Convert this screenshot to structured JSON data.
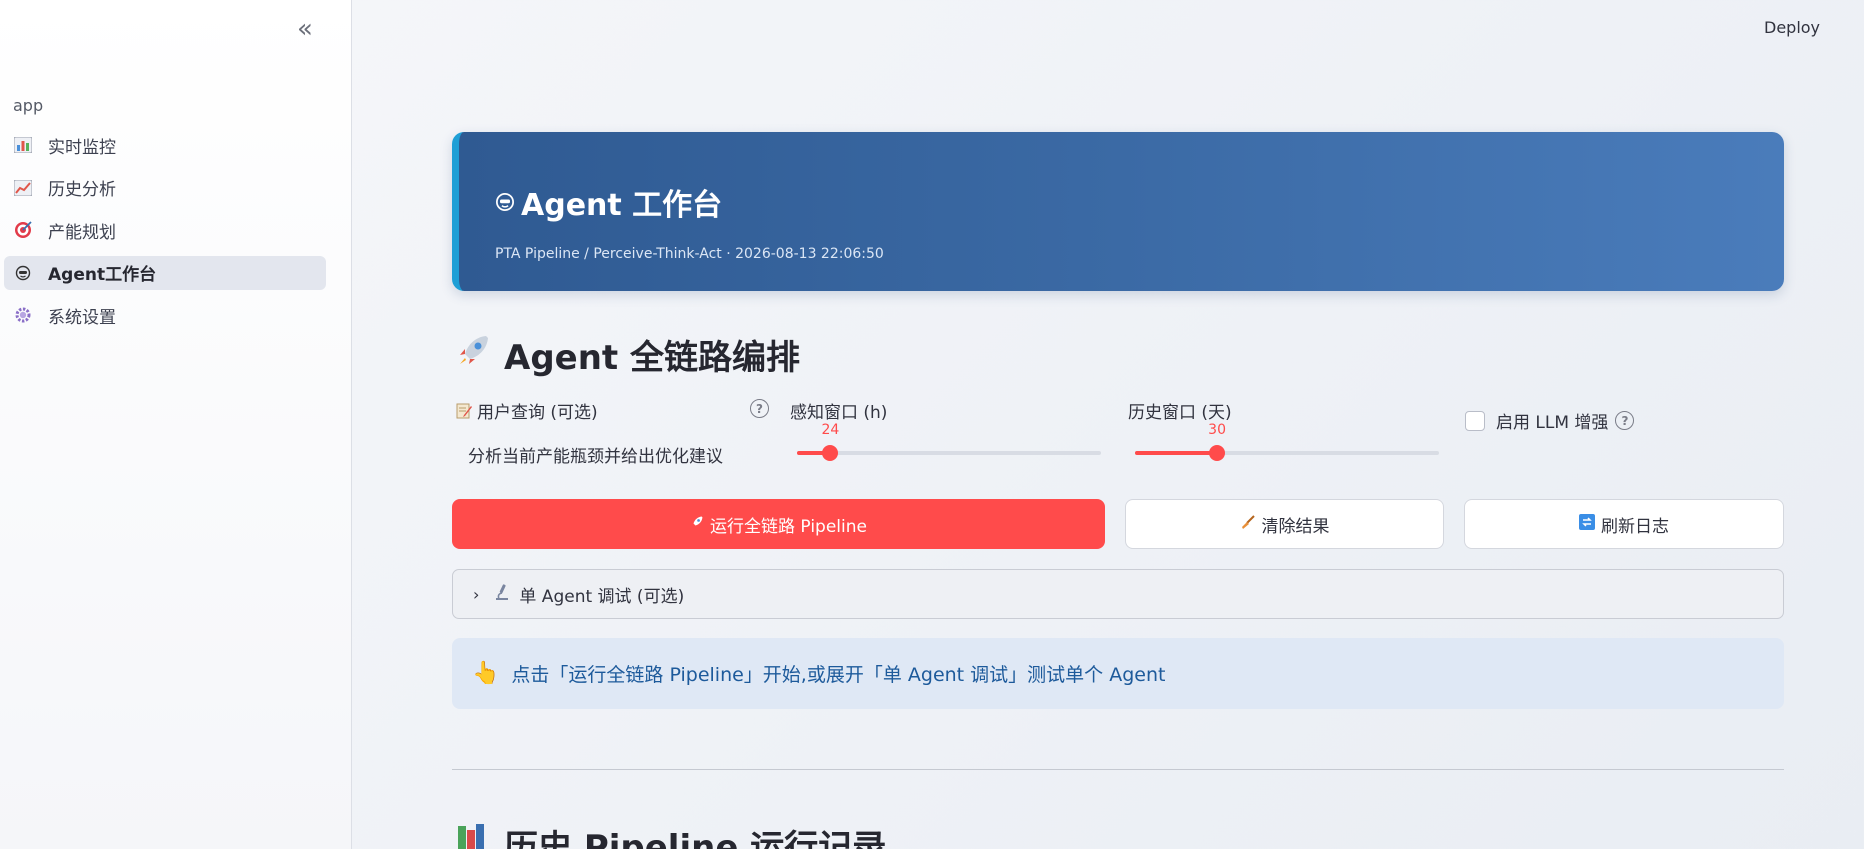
{
  "sidebar": {
    "app_label": "app",
    "items": [
      {
        "label": "实时监控",
        "icon": "bar-chart-icon"
      },
      {
        "label": "历史分析",
        "icon": "line-chart-icon"
      },
      {
        "label": "产能规划",
        "icon": "target-icon"
      },
      {
        "label": "Agent工作台",
        "icon": "robot-icon",
        "active": true
      },
      {
        "label": "系统设置",
        "icon": "gear-icon"
      }
    ]
  },
  "topbar": {
    "deploy_label": "Deploy"
  },
  "hero": {
    "title": "Agent 工作台",
    "subtitle": "PTA Pipeline / Perceive-Think-Act · 2026-08-13 22:06:50"
  },
  "section": {
    "title": "Agent 全链路编排"
  },
  "form": {
    "query_label": "用户查询 (可选)",
    "query_value": "分析当前产能瓶颈并给出优化建议",
    "perceive_label": "感知窗口 (h)",
    "perceive_value": 24,
    "perceive_fraction": 0.11,
    "history_label": "历史窗口 (天)",
    "history_value": 30,
    "history_fraction": 0.27,
    "llm_label": "启用 LLM 增强"
  },
  "buttons": {
    "run": "运行全链路 Pipeline",
    "clear": "清除结果",
    "refresh": "刷新日志"
  },
  "expander": {
    "label": "单 Agent 调试 (可选)"
  },
  "info": {
    "text": "点击「运行全链路 Pipeline」开始,或展开「单 Agent 调试」测试单个 Agent"
  },
  "history": {
    "title": "历史 Pipeline 运行记录"
  },
  "colors": {
    "accent": "#ff4b4b",
    "hero": "#3b6aa5",
    "info_text": "#1d5a9b"
  }
}
